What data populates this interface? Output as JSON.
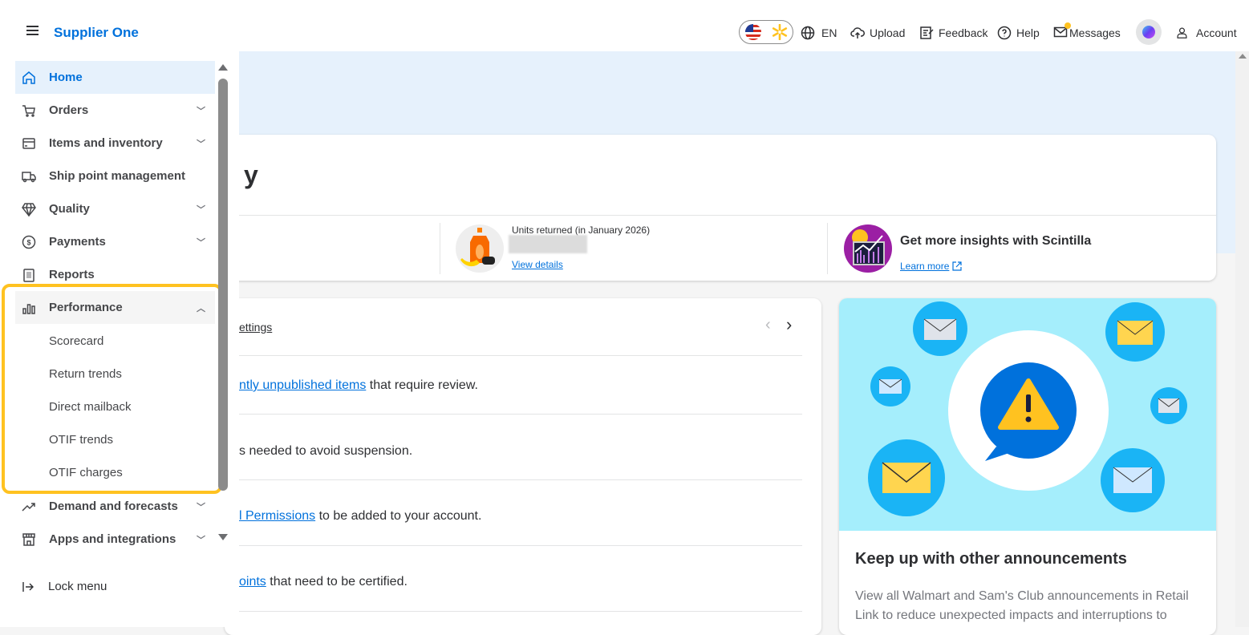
{
  "header": {
    "brand": "Supplier One",
    "language": "EN",
    "upload": "Upload",
    "feedback": "Feedback",
    "help": "Help",
    "messages": "Messages",
    "account": "Account"
  },
  "sidebar": {
    "items": [
      {
        "label": "Home",
        "icon": "home-icon",
        "active": true
      },
      {
        "label": "Orders",
        "icon": "cart-icon",
        "expandable": true
      },
      {
        "label": "Items and inventory",
        "icon": "box-icon",
        "expandable": true
      },
      {
        "label": "Ship point management",
        "icon": "truck-icon"
      },
      {
        "label": "Quality",
        "icon": "diamond-icon",
        "expandable": true
      },
      {
        "label": "Payments",
        "icon": "dollar-icon",
        "expandable": true
      },
      {
        "label": "Reports",
        "icon": "clipboard-icon"
      },
      {
        "label": "Performance",
        "icon": "bar-chart-icon",
        "expanded": true
      },
      {
        "label": "Demand and forecasts",
        "icon": "trend-icon",
        "expandable": true
      },
      {
        "label": "Apps and integrations",
        "icon": "store-icon",
        "expandable": true
      }
    ],
    "performance_subitems": [
      "Scorecard",
      "Return trends",
      "Direct mailback",
      "OTIF trends",
      "OTIF charges"
    ],
    "lock_menu": "Lock menu",
    "highlight_color": "#ffc220"
  },
  "summary": {
    "title_fragment": "y",
    "units_returned_label": "Units returned (in January 2026)",
    "view_details": "View details",
    "scintilla_title": "Get more insights with Scintilla",
    "learn_more": "Learn more"
  },
  "tasks": {
    "header_link": "ettings",
    "rows": [
      {
        "link": "ntly unpublished items",
        "text": " that require review."
      },
      {
        "link": "",
        "text": "s needed to avoid suspension."
      },
      {
        "link": "l Permissions",
        "text": " to be added to your account."
      },
      {
        "link": "oints",
        "text": " that need to be certified."
      }
    ]
  },
  "announcement": {
    "title": "Keep up with other announcements",
    "body": "View all Walmart and Sam's Club announcements in Retail Link to reduce unexpected impacts and interruptions to"
  },
  "colors": {
    "brand": "#0071dc",
    "banner": "#e6f1fc",
    "illustration_bg": "#a5eefc"
  }
}
